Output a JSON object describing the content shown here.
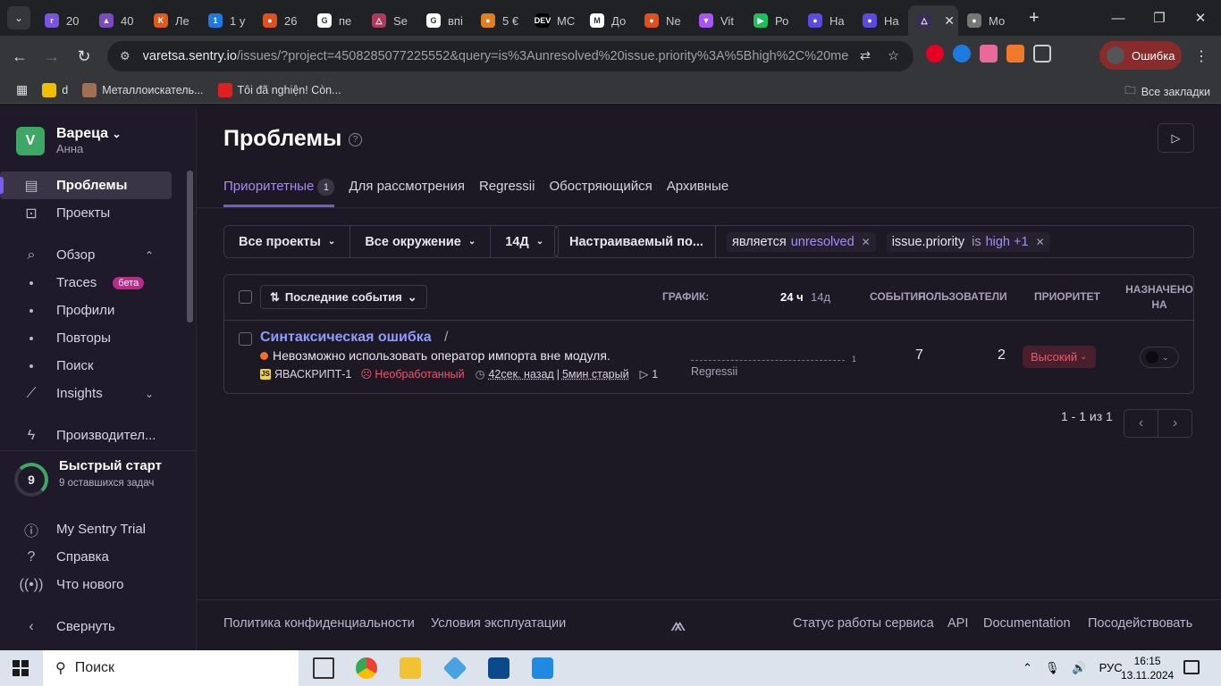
{
  "browser": {
    "tabs": [
      {
        "label": "20",
        "color": "#7a56e0",
        "icon": "r"
      },
      {
        "label": "40",
        "color": "#7a4cc0",
        "icon": "▲"
      },
      {
        "label": "Ле",
        "color": "#e05a1c",
        "icon": "K"
      },
      {
        "label": "1 у",
        "color": "#1d7ae0",
        "icon": "1"
      },
      {
        "label": "26",
        "color": "#e0501c",
        "icon": "●"
      },
      {
        "label": "пе",
        "color": "#ffffff",
        "icon": "G"
      },
      {
        "label": "Se",
        "color": "#b03a5c",
        "icon": "△"
      },
      {
        "label": "впі",
        "color": "#ffffff",
        "icon": "G"
      },
      {
        "label": "5 €",
        "color": "#e0801c",
        "icon": "●"
      },
      {
        "label": "МС",
        "color": "#000000",
        "icon": "DEV"
      },
      {
        "label": "До",
        "color": "#ffffff",
        "icon": "M"
      },
      {
        "label": "Ne",
        "color": "#e0501c",
        "icon": "●"
      },
      {
        "label": "Vit",
        "color": "#a855f7",
        "icon": "▼"
      },
      {
        "label": "Ро",
        "color": "#1cc05a",
        "icon": "▶"
      },
      {
        "label": "На",
        "color": "#5a4ae0",
        "icon": "●"
      },
      {
        "label": "На",
        "color": "#5a4ae0",
        "icon": "●"
      },
      {
        "label": "",
        "color": "#362d59",
        "icon": "△"
      },
      {
        "label": "Мо",
        "color": "#777777",
        "icon": "●"
      }
    ],
    "url_domain": "varetsa.sentry.io",
    "url_path": "/issues/?project=4508285077225552&query=is%3Aunresolved%20issue.priority%3A%5Bhigh%2C%20mediu...",
    "profile_label": "Ошибка",
    "bookmarks": [
      {
        "label": "d",
        "color": "#f0c000"
      },
      {
        "label": "Металлоискатель...",
        "color": "#a07050"
      },
      {
        "label": "Tôi đã nghiện! Còn...",
        "color": "#e02020"
      }
    ],
    "all_bookmarks": "Все закладки"
  },
  "sidebar": {
    "org_initial": "V",
    "org_name": "Вареца",
    "user_name": "Анна",
    "items": {
      "issues": "Проблемы",
      "projects": "Проекты",
      "explore": "Обзор",
      "traces": "Traces",
      "beta": "бета",
      "profiles": "Профили",
      "replays": "Повторы",
      "search": "Поиск",
      "insights": "Insights",
      "performance": "Производител..."
    },
    "quickstart": {
      "count": "9",
      "title": "Быстрый старт",
      "subtitle": "9         оставшихся задач"
    },
    "bottom": {
      "trial": "My Sentry Trial",
      "help": "Справка",
      "whats_new": "Что нового",
      "collapse": "Свернуть"
    }
  },
  "page": {
    "title": "Проблемы",
    "tabs": [
      {
        "label": "Приоритетные",
        "count": "1",
        "active": true
      },
      {
        "label": "Для рассмотрения"
      },
      {
        "label": "Regressii"
      },
      {
        "label": "Обостряющийся"
      },
      {
        "label": "Архивные"
      }
    ],
    "filters": {
      "projects": "Все проекты",
      "env": "Все окружение",
      "period": "14Д"
    },
    "search": {
      "label": "Настраиваемый по...",
      "tokens": [
        {
          "key": "является",
          "value": "unresolved"
        },
        {
          "key": "issue.priority",
          "op": "is",
          "value": "high +1"
        }
      ]
    },
    "table": {
      "sort": "Последние события",
      "col_graph": "ГРАФИК:",
      "col_24h": "24 ч",
      "col_14d": "14д",
      "col_events": "СОБЫТИЯ",
      "col_users": "ПОЛЬЗОВАТЕЛИ",
      "col_priority": "ПРИОРИТЕТ",
      "col_assigned": "НАЗНАЧЕНО НА",
      "issue": {
        "title": "Синтаксическая ошибка",
        "slash": "/",
        "message": "Невозможно использовать оператор импорта вне модуля.",
        "short_id": "ЯВАСКРИПТ-1",
        "status": "Необработанный",
        "last_seen": "42сек. назад",
        "age": "5мин старый",
        "replays": "1",
        "graph_max": "1",
        "graph_label": "Regressii",
        "events": "7",
        "users": "2",
        "priority": "Высокий"
      }
    },
    "pagination": "1 - 1 из 1",
    "footer": {
      "privacy": "Политика конфиденциальности",
      "terms": "Условия эксплуатации",
      "status": "Статус работы сервиса",
      "api": "API",
      "docs": "Documentation",
      "contribute": "Посодействовать"
    }
  },
  "taskbar": {
    "search": "Поиск",
    "lang": "РУС",
    "time": "16:15",
    "date": "13.11.2024"
  }
}
